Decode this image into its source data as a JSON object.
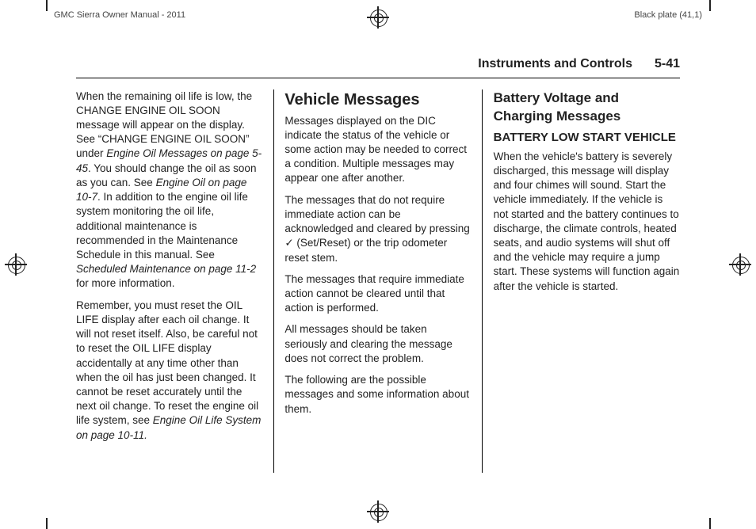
{
  "printer": {
    "left_label": "GMC Sierra Owner Manual - 2011",
    "right_label": "Black plate (41,1)"
  },
  "running_head": {
    "section": "Instruments and Controls",
    "page": "5-41"
  },
  "col1": {
    "p1a": "When the remaining oil life is low, the CHANGE ENGINE OIL SOON message will appear on the display. See “CHANGE ENGINE OIL SOON” under ",
    "p1_it1": "Engine Oil Messages on page 5-45",
    "p1b": ". You should change the oil as soon as you can. See ",
    "p1_it2": "Engine Oil on page 10-7",
    "p1c": ". In addition to the engine oil life system monitoring the oil life, additional maintenance is recommended in the Maintenance Schedule in this manual. See ",
    "p1_it3": "Scheduled Maintenance on page 11-2",
    "p1d": " for more information.",
    "p2a": "Remember, you must reset the OIL LIFE display after each oil change. It will not reset itself. Also, be careful not to reset the OIL LIFE display accidentally at any time other than when the oil has just been changed. It cannot be reset accurately until the next oil change. To reset the engine oil life system, see ",
    "p2_it1": "Engine Oil Life System on page 10-11.",
    "p2b": ""
  },
  "col2": {
    "h1": "Vehicle Messages",
    "p1": "Messages displayed on the DIC indicate the status of the vehicle or some action may be needed to correct a condition. Multiple messages may appear one after another.",
    "p2a": "The messages that do not require immediate action can be acknowledged and cleared by pressing ",
    "p2_check": "✓",
    "p2b": " (Set/Reset) or the trip odometer reset stem.",
    "p3": "The messages that require immediate action cannot be cleared until that action is performed.",
    "p4": "All messages should be taken seriously and clearing the message does not correct the problem.",
    "p5": "The following are the possible messages and some information about them."
  },
  "col3": {
    "h2": "Battery Voltage and Charging Messages",
    "h3": "BATTERY LOW START VEHICLE",
    "p1": "When the vehicle's battery is severely discharged, this message will display and four chimes will sound. Start the vehicle immediately. If the vehicle is not started and the battery continues to discharge, the climate controls, heated seats, and audio systems will shut off and the vehicle may require a jump start. These systems will function again after the vehicle is started."
  }
}
